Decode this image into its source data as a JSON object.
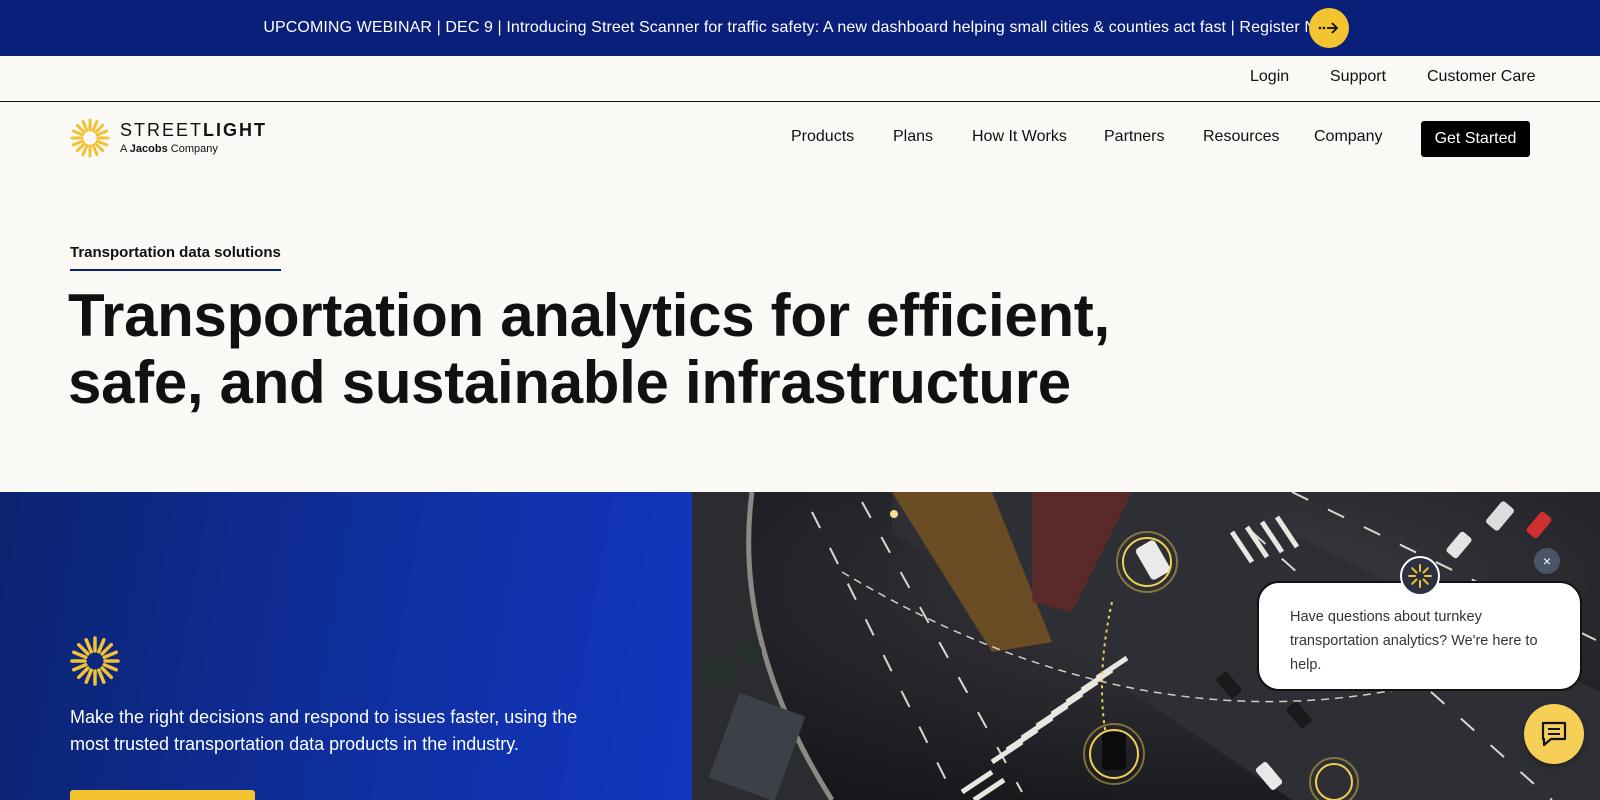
{
  "announcement": {
    "text": "UPCOMING WEBINAR | DEC 9 | Introducing Street Scanner for traffic safety: A new dashboard helping small cities & counties act fast | Register Now",
    "arrow_icon": "arrow-right-icon"
  },
  "utility_nav": {
    "items": [
      {
        "label": "Login"
      },
      {
        "label": "Support"
      },
      {
        "label": "Customer Care"
      }
    ]
  },
  "logo": {
    "brand_light": "STREET",
    "brand_bold": "LIGHT",
    "sub_prefix": "A ",
    "sub_bold": "Jacobs",
    "sub_suffix": " Company"
  },
  "main_nav": {
    "items": [
      {
        "label": "Products"
      },
      {
        "label": "Plans"
      },
      {
        "label": "How It Works"
      },
      {
        "label": "Partners"
      },
      {
        "label": "Resources"
      },
      {
        "label": "Company"
      }
    ],
    "cta_label": "Get Started"
  },
  "hero": {
    "eyebrow": "Transportation data solutions",
    "headline": "Transportation analytics for efficient, safe, and sustainable infrastructure"
  },
  "feature": {
    "description": "Make the right decisions and respond to issues faster, using the most trusted transportation data products in the industry."
  },
  "chat": {
    "message": "Have questions about turnkey transportation analytics? We're here to help.",
    "close_label": "×"
  },
  "colors": {
    "brand_blue": "#0a1f7a",
    "accent_yellow": "#f4c430"
  }
}
